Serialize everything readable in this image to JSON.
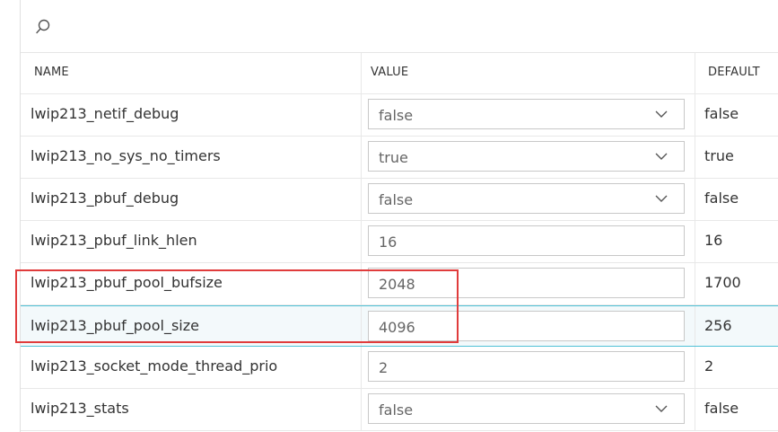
{
  "search": {
    "icon": "search-icon"
  },
  "columns": {
    "name": "NAME",
    "value": "VALUE",
    "default": "DEFAULT"
  },
  "rows": [
    {
      "name": "lwip213_netif_debug",
      "value": "false",
      "type": "select",
      "default": "false"
    },
    {
      "name": "lwip213_no_sys_no_timers",
      "value": "true",
      "type": "select",
      "default": "true"
    },
    {
      "name": "lwip213_pbuf_debug",
      "value": "false",
      "type": "select",
      "default": "false"
    },
    {
      "name": "lwip213_pbuf_link_hlen",
      "value": "16",
      "type": "input",
      "default": "16"
    },
    {
      "name": "lwip213_pbuf_pool_bufsize",
      "value": "2048",
      "type": "input",
      "default": "1700"
    },
    {
      "name": "lwip213_pbuf_pool_size",
      "value": "4096",
      "type": "input",
      "default": "256"
    },
    {
      "name": "lwip213_socket_mode_thread_prio",
      "value": "2",
      "type": "input",
      "default": "2"
    },
    {
      "name": "lwip213_stats",
      "value": "false",
      "type": "select",
      "default": "false"
    }
  ],
  "colors": {
    "highlight": "#e03c3c",
    "selected_border": "#4fc1d6",
    "selected_bg": "#f3f9fb"
  }
}
